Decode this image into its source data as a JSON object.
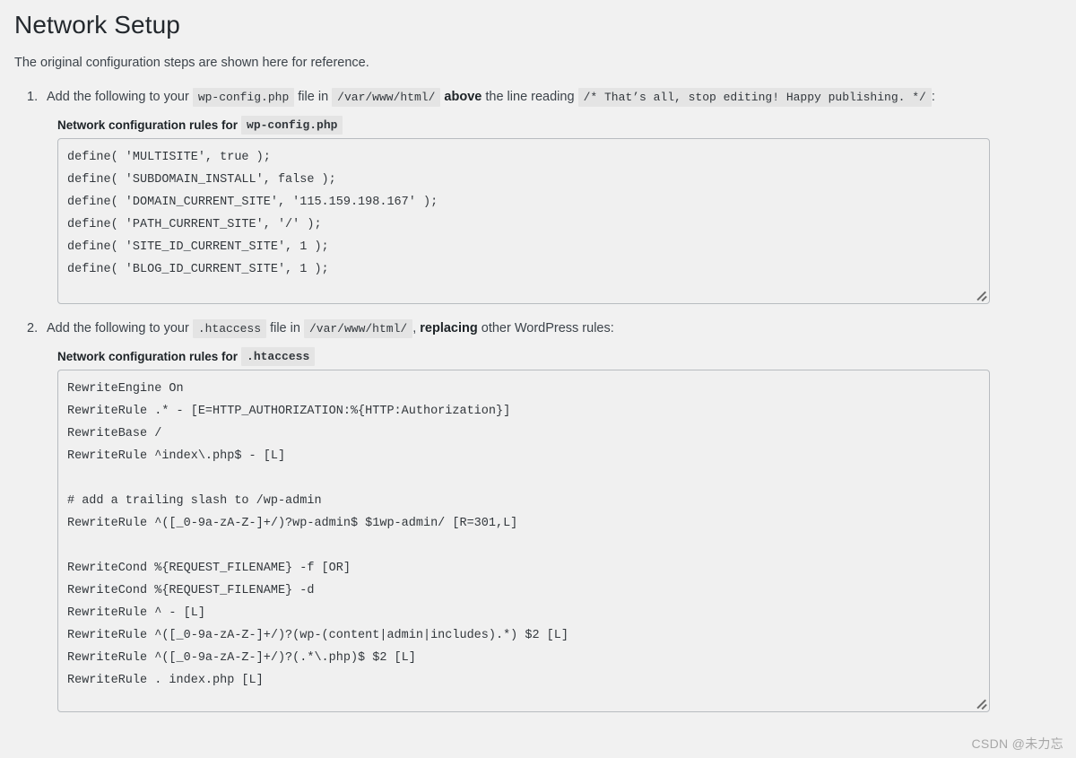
{
  "page": {
    "title": "Network Setup",
    "intro": "The original configuration steps are shown here for reference."
  },
  "steps": [
    {
      "number": "1.",
      "prefix": "Add the following to your",
      "file_code": "wp-config.php",
      "mid": "file in",
      "path_code": "/var/www/html/",
      "emphasis": "above",
      "after_emphasis": "the line reading",
      "marker_code": "/* That’s all, stop editing! Happy publishing. */",
      "suffix": ":",
      "label_prefix": "Network configuration rules for",
      "label_code": "wp-config.php",
      "content": "define( 'MULTISITE', true );\ndefine( 'SUBDOMAIN_INSTALL', false );\ndefine( 'DOMAIN_CURRENT_SITE', '115.159.198.167' );\ndefine( 'PATH_CURRENT_SITE', '/' );\ndefine( 'SITE_ID_CURRENT_SITE', 1 );\ndefine( 'BLOG_ID_CURRENT_SITE', 1 );"
    },
    {
      "number": "2.",
      "prefix": "Add the following to your",
      "file_code": ".htaccess",
      "mid": "file in",
      "path_code": "/var/www/html/",
      "emphasis": "replacing",
      "before_emphasis": ",",
      "after_emphasis": "other WordPress rules:",
      "label_prefix": "Network configuration rules for",
      "label_code": ".htaccess",
      "content": "RewriteEngine On\nRewriteRule .* - [E=HTTP_AUTHORIZATION:%{HTTP:Authorization}]\nRewriteBase /\nRewriteRule ^index\\.php$ - [L]\n\n# add a trailing slash to /wp-admin\nRewriteRule ^([_0-9a-zA-Z-]+/)?wp-admin$ $1wp-admin/ [R=301,L]\n\nRewriteCond %{REQUEST_FILENAME} -f [OR]\nRewriteCond %{REQUEST_FILENAME} -d\nRewriteRule ^ - [L]\nRewriteRule ^([_0-9a-zA-Z-]+/)?(wp-(content|admin|includes).*) $2 [L]\nRewriteRule ^([_0-9a-zA-Z-]+/)?(.*\\.php)$ $2 [L]\nRewriteRule . index.php [L]"
    }
  ],
  "watermark": "CSDN @未力忘",
  "colors": {
    "page_background": "#f1f1f1",
    "title_text": "#23282d",
    "body_text": "#3c434a",
    "code_tag_background": "#e4e4e4",
    "code_tag_text": "#32373c",
    "textarea_background": "#f0f0f0",
    "textarea_border": "#b8bcc0",
    "watermark_text": "#a7a7a7"
  }
}
